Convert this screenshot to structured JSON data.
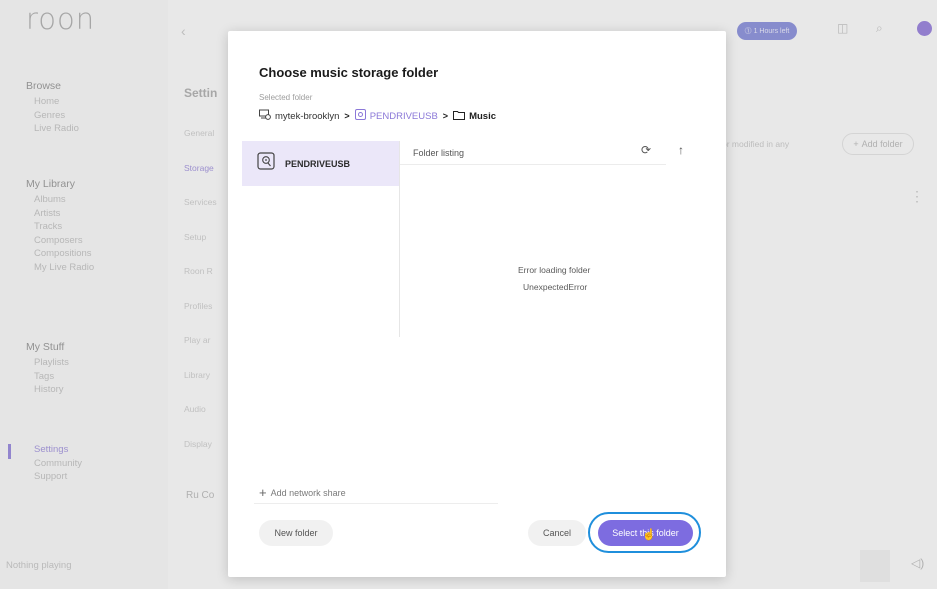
{
  "app": {
    "logo": "roon",
    "back_glyph": "‹",
    "top_pill": "⓵ 1 Hours left",
    "now_playing": "Nothing playing"
  },
  "sidebar": {
    "browse_header": "Browse",
    "browse_items": [
      "Home",
      "Genres",
      "Live Radio"
    ],
    "library_header": "My Library",
    "library_items": [
      "Albums",
      "Artists",
      "Tracks",
      "Composers",
      "Compositions",
      "My Live Radio"
    ],
    "stuff_header": "My Stuff",
    "stuff_items": [
      "Playlists",
      "Tags",
      "History"
    ],
    "bottom_items": [
      "Settings",
      "Community",
      "Support"
    ]
  },
  "settings_bg": {
    "title": "Settin",
    "tabs": [
      "General",
      "Storage",
      "Services",
      "Setup",
      "Roon R",
      "Profiles",
      "Play ar",
      "Library",
      "Audio",
      "Display"
    ],
    "right_text": "or modified in any",
    "add_folder": "Add folder",
    "bottom_text": "Ru Co"
  },
  "modal": {
    "title": "Choose music storage folder",
    "selected_label": "Selected folder",
    "breadcrumb": {
      "computer": "mytek-brooklyn",
      "drive": "PENDRIVEUSB",
      "folder": "Music",
      "separator": ">"
    },
    "drives": [
      "PENDRIVEUSB"
    ],
    "listing_header": "Folder listing",
    "refresh_glyph": "⟳",
    "up_glyph": "↑",
    "error_title": "Error loading folder",
    "error_detail": "UnexpectedError",
    "add_network_share": "Add network share",
    "buttons": {
      "new_folder": "New folder",
      "cancel": "Cancel",
      "select": "Select this folder"
    }
  },
  "colors": {
    "accent": "#7d6ce0",
    "selected_row": "#ebe7f9",
    "highlight_ring": "#1f8fdc"
  }
}
